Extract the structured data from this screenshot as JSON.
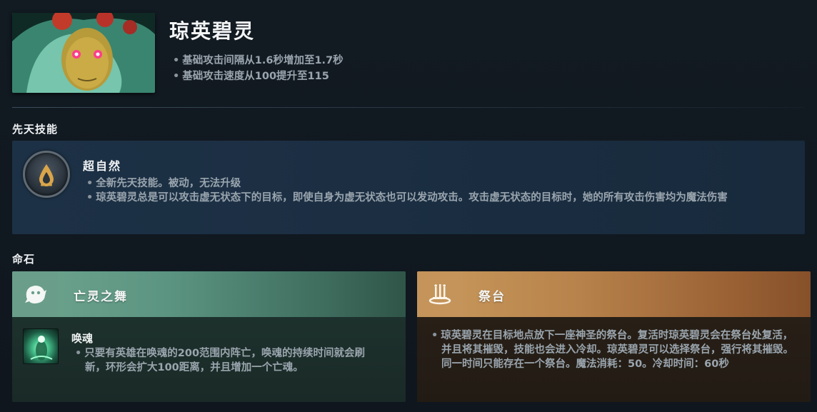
{
  "hero": {
    "name": "琼英碧灵",
    "notes": [
      "基础攻击间隔从1.6秒增加至1.7秒",
      "基础攻击速度从100提升至115"
    ]
  },
  "innate": {
    "section_title": "先天技能",
    "ability_name": "超自然",
    "icon": "droplet-icon",
    "notes": [
      "全新先天技能。被动，无法升级",
      "琼英碧灵总是可以攻击虚无状态下的目标，即使自身为虚无状态也可以发动攻击。攻击虚无状态的目标时，她的所有攻击伤害均为魔法伤害"
    ]
  },
  "facets": {
    "section_title": "命石",
    "items": [
      {
        "name": "亡灵之舞",
        "icon": "spirit-icon",
        "color": "#6a9e8a",
        "ability_name": "唤魂",
        "notes": [
          "只要有英雄在唤魂的200范围内阵亡，唤魂的持续时间就会刷新，环形会扩大100距离，并且增加一个亡魂。"
        ]
      },
      {
        "name": "祭台",
        "icon": "altar-icon",
        "color": "#c4945a",
        "notes": [
          "琼英碧灵在目标地点放下一座神圣的祭台。复活时琼英碧灵会在祭台处复活，并且将其摧毁，技能也会进入冷却。琼英碧灵可以选择祭台，强行将其摧毁。同一时间只能存在一个祭台。魔法消耗：50。冷却时间：60秒"
        ]
      }
    ]
  }
}
